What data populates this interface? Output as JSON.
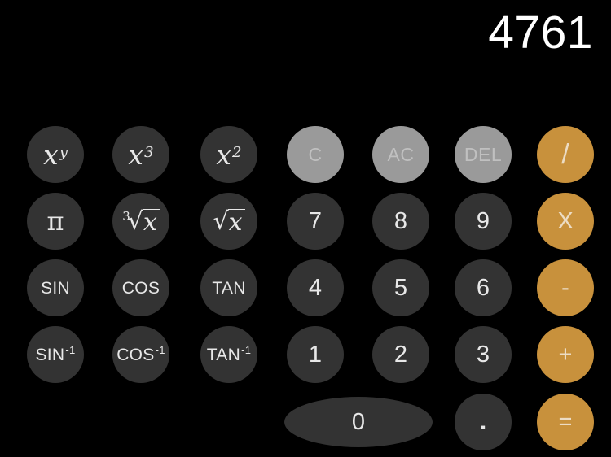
{
  "app": {
    "name": "Scientific Calculator",
    "background_color": "#000000"
  },
  "display": {
    "value": "4761",
    "text_color": "#ffffff",
    "align": "right"
  },
  "palette": {
    "dark_key": "#333333",
    "gray_key": "#9a9a9a",
    "accent_key": "#c8913c",
    "dark_key_text": "#e8e8e8",
    "gray_key_text": "#c0c0c0",
    "accent_key_text": "#ecdcc4"
  },
  "keys": {
    "pow_xy": {
      "base": "x",
      "exponent": "y",
      "aria": "x to the power y"
    },
    "pow_x3": {
      "base": "x",
      "exponent": "3",
      "aria": "x cubed"
    },
    "pow_x2": {
      "base": "x",
      "exponent": "2",
      "aria": "x squared"
    },
    "clear": "C",
    "all_clear": "AC",
    "delete": "DEL",
    "divide": "/",
    "pi": "π",
    "cbrt": {
      "index": "3",
      "radical": "√",
      "body": "x",
      "aria": "cube root of x"
    },
    "sqrt": {
      "index": "",
      "radical": "√",
      "body": "x",
      "aria": "square root of x"
    },
    "seven": "7",
    "eight": "8",
    "nine": "9",
    "multiply": "X",
    "sin": "SIN",
    "cos": "COS",
    "tan": "TAN",
    "four": "4",
    "five": "5",
    "six": "6",
    "minus": "-",
    "asin": {
      "name": "SIN",
      "sup": "-1"
    },
    "acos": {
      "name": "COS",
      "sup": "-1"
    },
    "atan": {
      "name": "TAN",
      "sup": "-1"
    },
    "one": "1",
    "two": "2",
    "three": "3",
    "plus": "+",
    "zero": "0",
    "decimal": ".",
    "equals": "="
  }
}
